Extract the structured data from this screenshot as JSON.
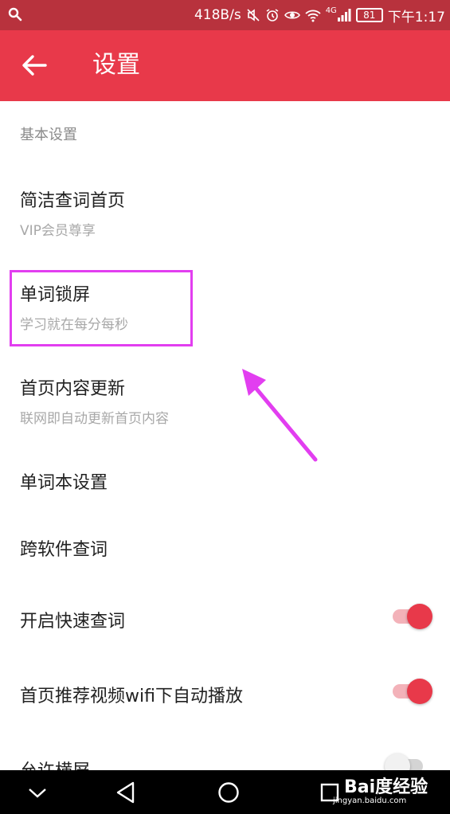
{
  "status_bar": {
    "speed": "418B/s",
    "network": "4G",
    "battery": "81",
    "time": "下午1:17",
    "icons": [
      "search-icon",
      "mute-icon",
      "alarm-icon",
      "eye-icon",
      "wifi-icon",
      "signal-icon",
      "battery-icon"
    ]
  },
  "app_bar": {
    "title": "设置",
    "back_icon": "arrow-left-icon"
  },
  "section": {
    "header": "基本设置"
  },
  "rows": [
    {
      "title": "简洁查词首页",
      "subtitle": "VIP会员尊享"
    },
    {
      "title": "单词锁屏",
      "subtitle": "学习就在每分每秒"
    },
    {
      "title": "首页内容更新",
      "subtitle": "联网即自动更新首页内容"
    },
    {
      "title": "单词本设置"
    },
    {
      "title": "跨软件查词"
    },
    {
      "title": "开启快速查词",
      "toggle": true
    },
    {
      "title": "首页推荐视频wifi下自动播放",
      "toggle": true
    },
    {
      "title": "允许横屏",
      "toggle": false
    }
  ],
  "annotation": {
    "color": "#e23ef0"
  },
  "nav_bar": {
    "buttons": [
      "chevron-down-icon",
      "back-triangle-icon",
      "home-circle-icon",
      "recents-square-icon"
    ]
  },
  "watermark": {
    "logo": "Bai度经验",
    "site": "jingyan.baidu.com"
  },
  "colors": {
    "primary": "#e8394a",
    "status_bar": "#b8323d",
    "toggle_track_on": "#f3b2b9"
  }
}
